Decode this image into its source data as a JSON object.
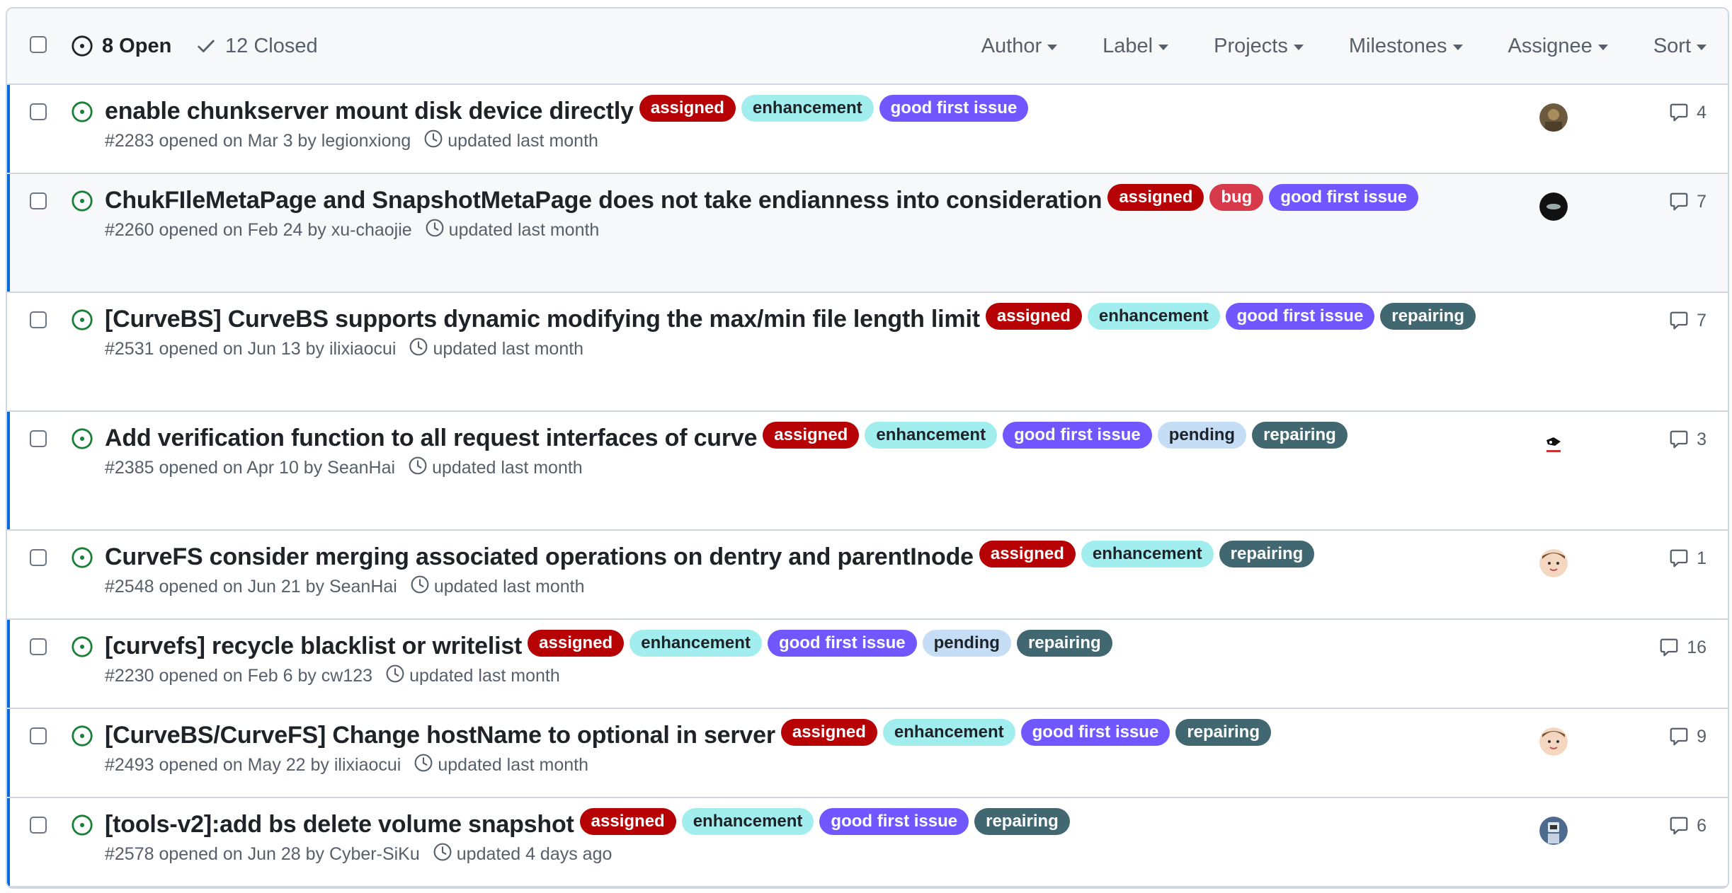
{
  "header": {
    "open_label": "8 Open",
    "closed_label": "12 Closed",
    "filters": [
      "Author",
      "Label",
      "Projects",
      "Milestones",
      "Assignee",
      "Sort"
    ]
  },
  "label_colors": {
    "assigned": {
      "bg": "#b60205",
      "fg": "#ffffff"
    },
    "enhancement": {
      "bg": "#a2eeef",
      "fg": "#1f2328"
    },
    "good first issue": {
      "bg": "#7057ff",
      "fg": "#ffffff"
    },
    "bug": {
      "bg": "#d73a4a",
      "fg": "#ffffff"
    },
    "repairing": {
      "bg": "#416770",
      "fg": "#ffffff"
    },
    "pending": {
      "bg": "#c5def5",
      "fg": "#1f2328"
    }
  },
  "issues": [
    {
      "title": "enable chunkserver mount disk device directly",
      "labels": [
        "assigned",
        "enhancement",
        "good first issue"
      ],
      "number": "#2283",
      "opened": "opened on Mar 3 by legionxiong",
      "updated": "updated last month",
      "comments": "4",
      "avatar": "avatar-1"
    },
    {
      "title": "ChukFIleMetaPage and SnapshotMetaPage does not take endianness into consideration",
      "labels": [
        "assigned",
        "bug",
        "good first issue"
      ],
      "number": "#2260",
      "opened": "opened on Feb 24 by xu-chaojie",
      "updated": "updated last month",
      "comments": "7",
      "avatar": "avatar-2"
    },
    {
      "title": "[CurveBS] CurveBS supports dynamic modifying the max/min file length limit",
      "labels": [
        "assigned",
        "enhancement",
        "good first issue",
        "repairing"
      ],
      "number": "#2531",
      "opened": "opened on Jun 13 by ilixiaocui",
      "updated": "updated last month",
      "comments": "7",
      "avatar": ""
    },
    {
      "title": "Add verification function to all request interfaces of curve",
      "labels": [
        "assigned",
        "enhancement",
        "good first issue",
        "pending",
        "repairing"
      ],
      "number": "#2385",
      "opened": "opened on Apr 10 by SeanHai",
      "updated": "updated last month",
      "comments": "3",
      "avatar": "avatar-3"
    },
    {
      "title": "CurveFS consider merging associated operations on dentry and parentInode",
      "labels": [
        "assigned",
        "enhancement",
        "repairing"
      ],
      "number": "#2548",
      "opened": "opened on Jun 21 by SeanHai",
      "updated": "updated last month",
      "comments": "1",
      "avatar": "avatar-4"
    },
    {
      "title": "[curvefs] recycle blacklist or writelist",
      "labels": [
        "assigned",
        "enhancement",
        "good first issue",
        "pending",
        "repairing"
      ],
      "number": "#2230",
      "opened": "opened on Feb 6 by cw123",
      "updated": "updated last month",
      "comments": "16",
      "avatar": ""
    },
    {
      "title": "[CurveBS/CurveFS] Change hostName to optional in server",
      "labels": [
        "assigned",
        "enhancement",
        "good first issue",
        "repairing"
      ],
      "number": "#2493",
      "opened": "opened on May 22 by ilixiaocui",
      "updated": "updated last month",
      "comments": "9",
      "avatar": "avatar-4"
    },
    {
      "title": "[tools-v2]:add bs delete volume snapshot",
      "labels": [
        "assigned",
        "enhancement",
        "good first issue",
        "repairing"
      ],
      "number": "#2578",
      "opened": "opened on Jun 28 by Cyber-SiKu",
      "updated": "updated 4 days ago",
      "comments": "6",
      "avatar": "avatar-5"
    }
  ]
}
